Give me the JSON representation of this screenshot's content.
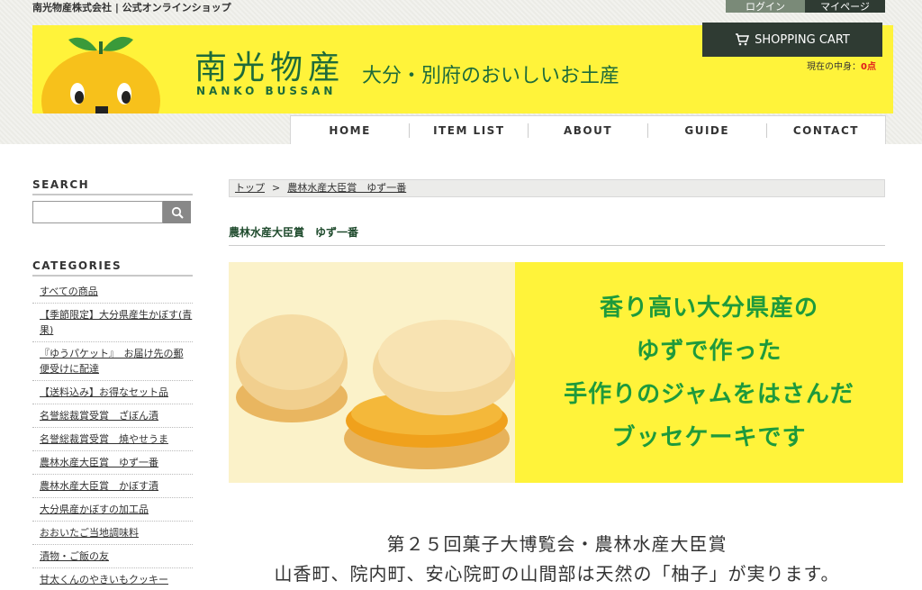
{
  "header": {
    "company": "南光物産株式会社 | 公式オンラインショップ",
    "login_label": "ログイン",
    "mypage_label": "マイページ",
    "logo_jp": "南光物産",
    "logo_en": "NANKO BUSSAN",
    "tagline": "大分・別府のおいしいお土産",
    "cart_label": "SHOPPING CART",
    "cart_status_prefix": "現在の中身：",
    "cart_status_value": "0点",
    "brand_color": "#fff33a",
    "accent_color": "#1e6b3a"
  },
  "nav": {
    "items": [
      "HOME",
      "ITEM LIST",
      "ABOUT",
      "GUIDE",
      "CONTACT"
    ]
  },
  "sidebar": {
    "search_heading": "SEARCH",
    "search_value": "",
    "categories_heading": "CATEGORIES",
    "categories": [
      "すべての商品",
      "【季節限定】大分県産生かぼす(青果)",
      "『ゆうパケット』　お届け先の郵便受けに配達",
      "【送料込み】お得なセット品",
      "名誉総裁賞受賞　ざぼん漬",
      "名誉総裁賞受賞　焼やせうま",
      "農林水産大臣賞　ゆず一番",
      "農林水産大臣賞　かぼす漬",
      "大分県産かぼすの加工品",
      "おおいたご当地調味料",
      "漬物・ご飯の友",
      "甘太くんのやきいもクッキー"
    ]
  },
  "main": {
    "breadcrumb_top": "トップ",
    "breadcrumb_sep": ">",
    "breadcrumb_current": "農林水産大臣賞　ゆず一番",
    "title": "農林水産大臣賞　ゆず一番",
    "hero_lines": [
      "香り高い大分県産の",
      "ゆずで作った",
      "手作りのジャムをはさんだ",
      "ブッセケーキです"
    ],
    "description_1": "第２５回菓子大博覧会・農林水産大臣賞",
    "description_2": "山香町、院内町、安心院町の山間部は天然の「柚子」が実ります。"
  }
}
